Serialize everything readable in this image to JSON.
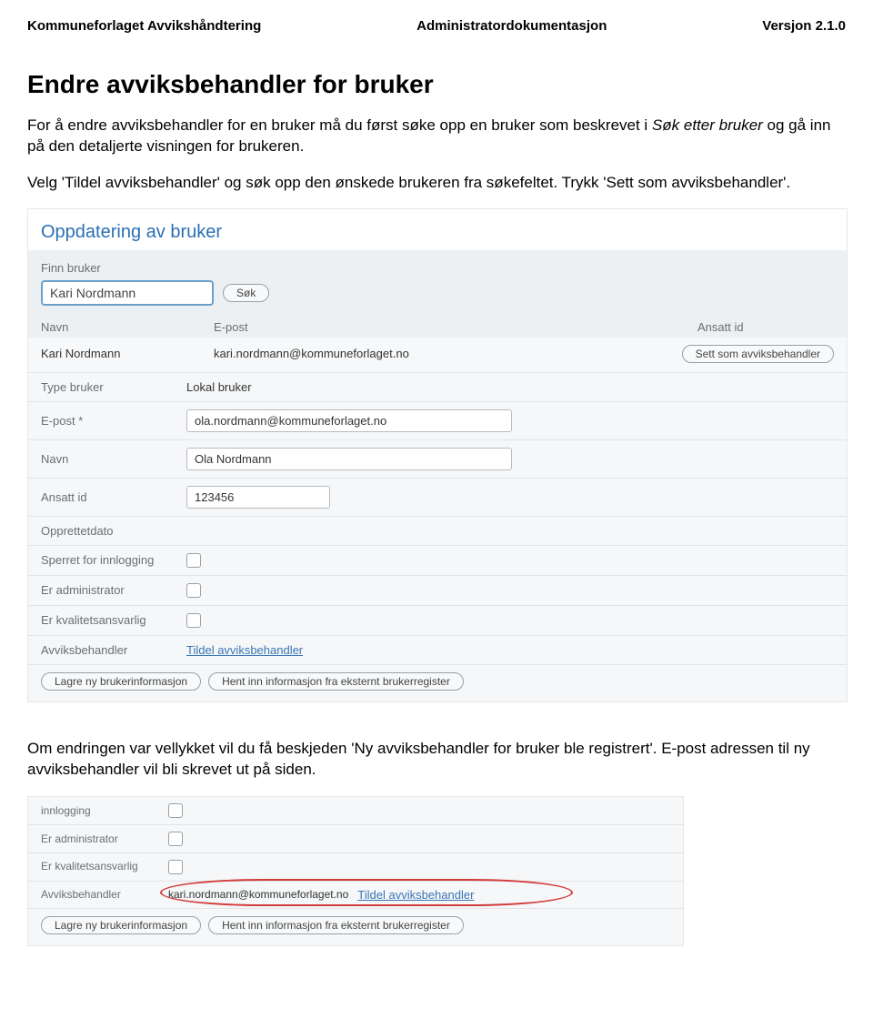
{
  "header": {
    "left": "Kommuneforlaget Avvikshåndtering",
    "center": "Administratordokumentasjon",
    "right": "Versjon 2.1.0"
  },
  "title": "Endre avviksbehandler for bruker",
  "intro_part1": "For å endre avviksbehandler for en bruker må du først søke opp en bruker som beskrevet i ",
  "intro_em": "Søk etter bruker",
  "intro_part2": " og gå inn på den detaljerte visningen for brukeren.",
  "intro_part3": "Velg 'Tildel avviksbehandler' og søk opp den ønskede brukeren fra søkefeltet. Trykk 'Sett som avviksbehandler'.",
  "ss1": {
    "title": "Oppdatering av bruker",
    "find_label": "Finn bruker",
    "find_value": "Kari Nordmann",
    "search_btn": "Søk",
    "cols": {
      "navn": "Navn",
      "epost": "E-post",
      "ansatt": "Ansatt id"
    },
    "result": {
      "navn": "Kari Nordmann",
      "epost": "kari.nordmann@kommuneforlaget.no"
    },
    "set_btn": "Sett som avviksbehandler",
    "rows": {
      "type_bruker_label": "Type bruker",
      "type_bruker_value": "Lokal bruker",
      "epost_label": "E-post *",
      "epost_value": "ola.nordmann@kommuneforlaget.no",
      "navn_label": "Navn",
      "navn_value": "Ola Nordmann",
      "ansatt_label": "Ansatt id",
      "ansatt_value": "123456",
      "opprettet_label": "Opprettetdato",
      "sperret_label": "Sperret for innlogging",
      "admin_label": "Er administrator",
      "kvalitet_label": "Er kvalitetsansvarlig",
      "avvik_label": "Avviksbehandler",
      "avvik_link": "Tildel avviksbehandler"
    },
    "actions": {
      "save": "Lagre ny brukerinformasjon",
      "fetch": "Hent inn informasjon fra eksternt brukerregister"
    }
  },
  "outro": "Om endringen var vellykket vil du få beskjeden 'Ny avviksbehandler for bruker ble registrert'. E-post adressen til ny avviksbehandler vil bli skrevet ut på siden.",
  "ss2": {
    "rows": {
      "innlogging_label": "innlogging",
      "admin_label": "Er administrator",
      "kvalitet_label": "Er kvalitetsansvarlig",
      "avvik_label": "Avviksbehandler",
      "avvik_email": "kari.nordmann@kommuneforlaget.no",
      "avvik_link": "Tildel avviksbehandler"
    },
    "actions": {
      "save": "Lagre ny brukerinformasjon",
      "fetch": "Hent inn informasjon fra eksternt brukerregister"
    }
  }
}
